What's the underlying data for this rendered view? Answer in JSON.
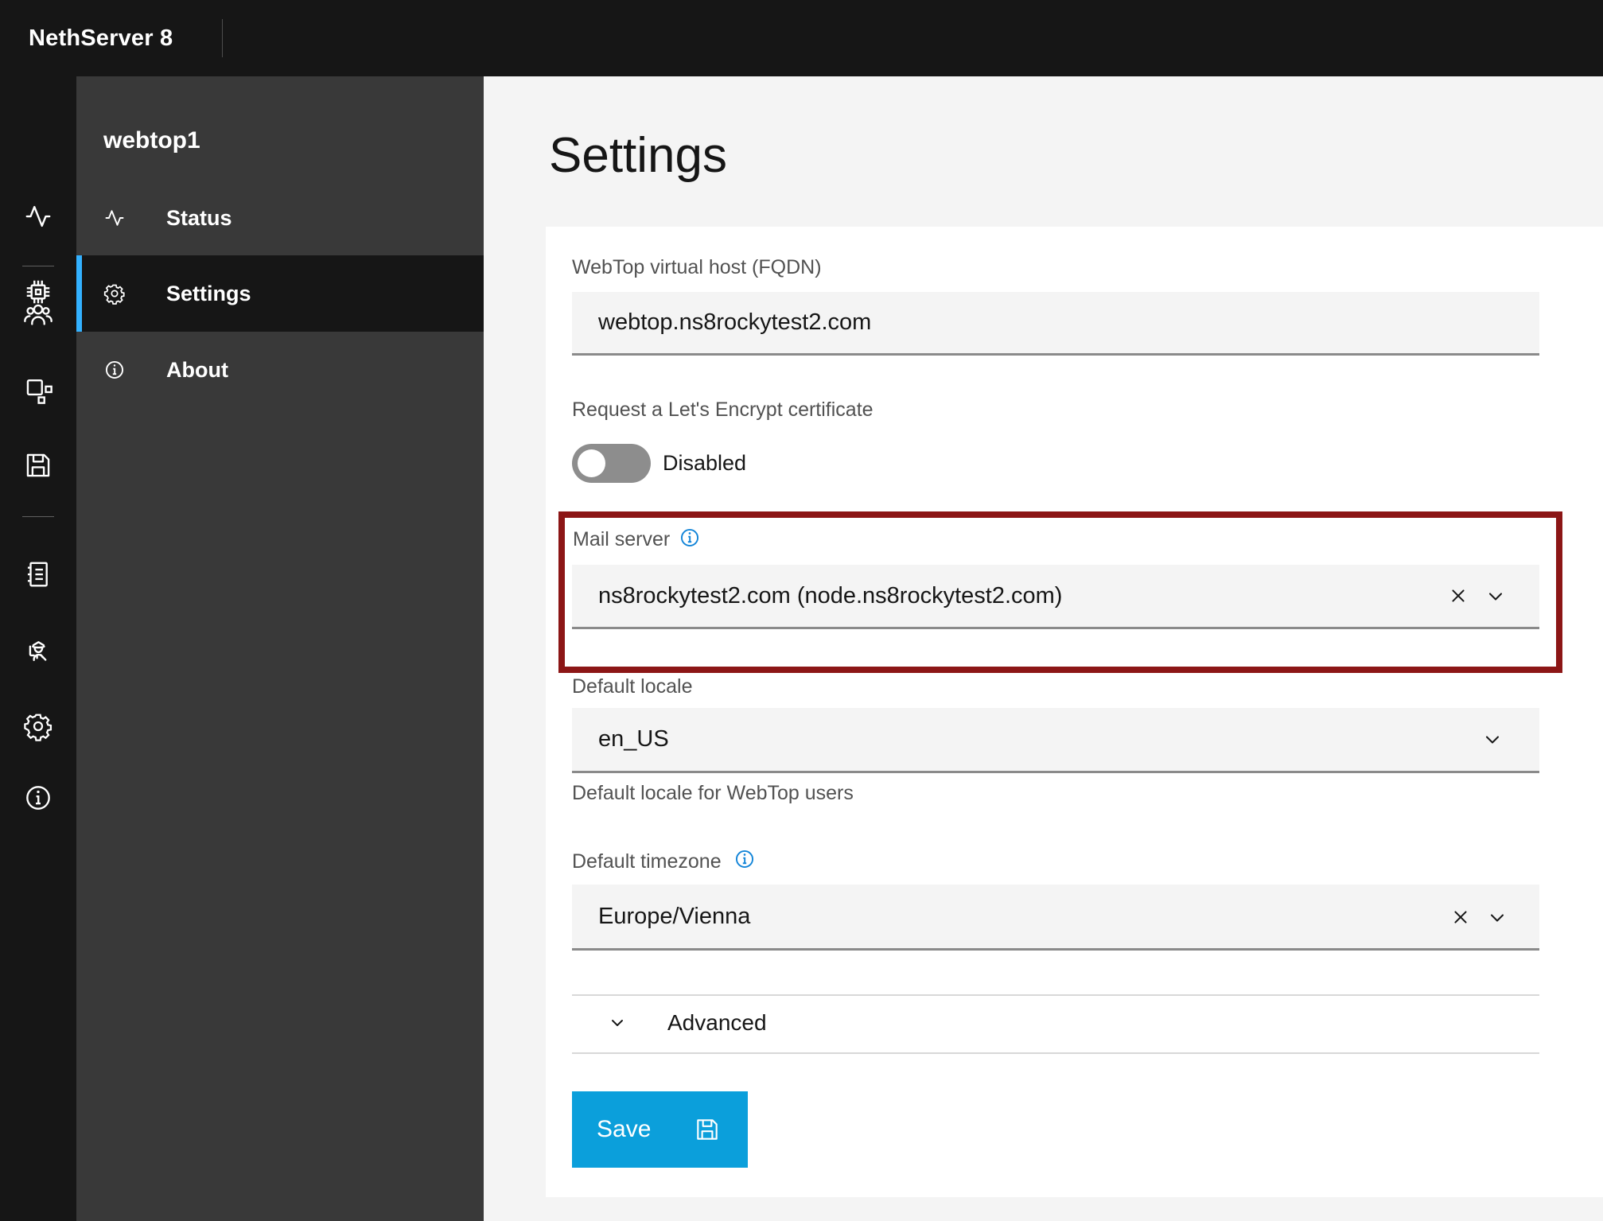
{
  "header": {
    "brand": "NethServer 8"
  },
  "nav_rail": {
    "icons": [
      "activity",
      "chip",
      "group",
      "workspace",
      "save",
      "catalog",
      "security",
      "settings",
      "information"
    ]
  },
  "sidebar": {
    "app_name": "webtop1",
    "items": [
      {
        "label": "Status",
        "icon": "activity-icon",
        "active": false
      },
      {
        "label": "Settings",
        "icon": "settings-icon",
        "active": true
      },
      {
        "label": "About",
        "icon": "information-icon",
        "active": false
      }
    ]
  },
  "page": {
    "title": "Settings",
    "form": {
      "virtual_host": {
        "label": "WebTop virtual host (FQDN)",
        "value": "webtop.ns8rockytest2.com"
      },
      "lets_encrypt": {
        "label": "Request a Let's Encrypt certificate",
        "state_label": "Disabled",
        "enabled": false
      },
      "mail_server": {
        "label": "Mail server",
        "value": "ns8rockytest2.com (node.ns8rockytest2.com)",
        "has_info_icon": true,
        "annotated": true
      },
      "default_locale": {
        "label": "Default locale",
        "value": "en_US",
        "helper_text": "Default locale for WebTop users"
      },
      "default_timezone": {
        "label": "Default timezone",
        "value": "Europe/Vienna",
        "has_info_icon": true
      }
    },
    "advanced": {
      "label": "Advanced",
      "expanded": false
    },
    "save_button": {
      "label": "Save"
    }
  },
  "colors": {
    "header_bg": "#161616",
    "rail_bg": "#161616",
    "sidebar_bg": "#393939",
    "active_item_bg": "#161616",
    "active_indicator": "#33b1ff",
    "page_bg": "#f4f4f4",
    "card_bg": "#ffffff",
    "field_bg": "#f4f4f4",
    "field_border": "#8a8a8a",
    "label_text": "#525252",
    "value_text": "#161616",
    "toggle_off": "#8d8d8d",
    "info_icon_blue": "#1385d8",
    "annotation_red": "#8c1616",
    "save_button_bg": "#0b9fdb"
  }
}
